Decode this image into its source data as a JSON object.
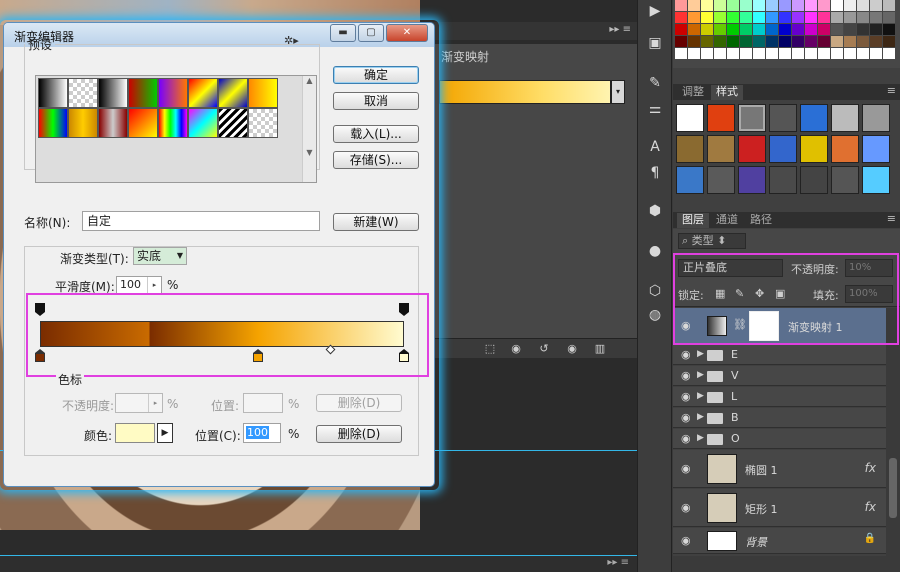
{
  "dialog": {
    "title": "渐变编辑器",
    "presets_legend": "预设",
    "buttons": {
      "ok": "确定",
      "cancel": "取消",
      "load": "载入(L)...",
      "save": "存储(S)...",
      "new": "新建(W)"
    },
    "name_label": "名称(N):",
    "name_value": "自定",
    "gradient_type_label": "渐变类型(T):",
    "gradient_type_value": "实底",
    "smoothness_label": "平滑度(M):",
    "smoothness_value": "100",
    "percent": "%",
    "stops_legend": "色标",
    "opacity_label": "不透明度:",
    "opacity_position_label": "位置:",
    "delete_label": "删除(D)",
    "color_label": "颜色:",
    "color_position_label": "位置(C):",
    "color_position_value": "100",
    "color_stop_color": "#fffbc4",
    "gradient_stops": [
      {
        "position": 0,
        "color": "#7a2c00"
      },
      {
        "position": 60,
        "color": "#f5a300"
      },
      {
        "position": 100,
        "color": "#fffbd0"
      }
    ]
  },
  "properties": {
    "title": "渐变映射"
  },
  "panels": {
    "tabs_top": [
      "调整",
      "样式"
    ],
    "tabs_layers": [
      "图层",
      "通道",
      "路径"
    ],
    "filter_label": "类型",
    "blend_mode": "正片叠底",
    "opacity_label": "不透明度:",
    "opacity_value": "10%",
    "lock_label": "锁定:",
    "fill_label": "填充:",
    "fill_value": "100%"
  },
  "layers": [
    {
      "name": "渐变映射 1",
      "kind": "adjustment",
      "selected": true
    },
    {
      "name": "E",
      "kind": "group"
    },
    {
      "name": "V",
      "kind": "group"
    },
    {
      "name": "L",
      "kind": "group"
    },
    {
      "name": "B",
      "kind": "group"
    },
    {
      "name": "O",
      "kind": "group"
    },
    {
      "name": "椭圆 1",
      "kind": "shape",
      "fx": true
    },
    {
      "name": "矩形 1",
      "kind": "shape",
      "fx": true
    },
    {
      "name": "背景",
      "kind": "background"
    }
  ],
  "icons": {
    "fx": "fx"
  },
  "colors": {
    "highlight": "#e040e0",
    "dialog_glow": "#29b6f6",
    "selected_layer": "#5b6f8e"
  }
}
